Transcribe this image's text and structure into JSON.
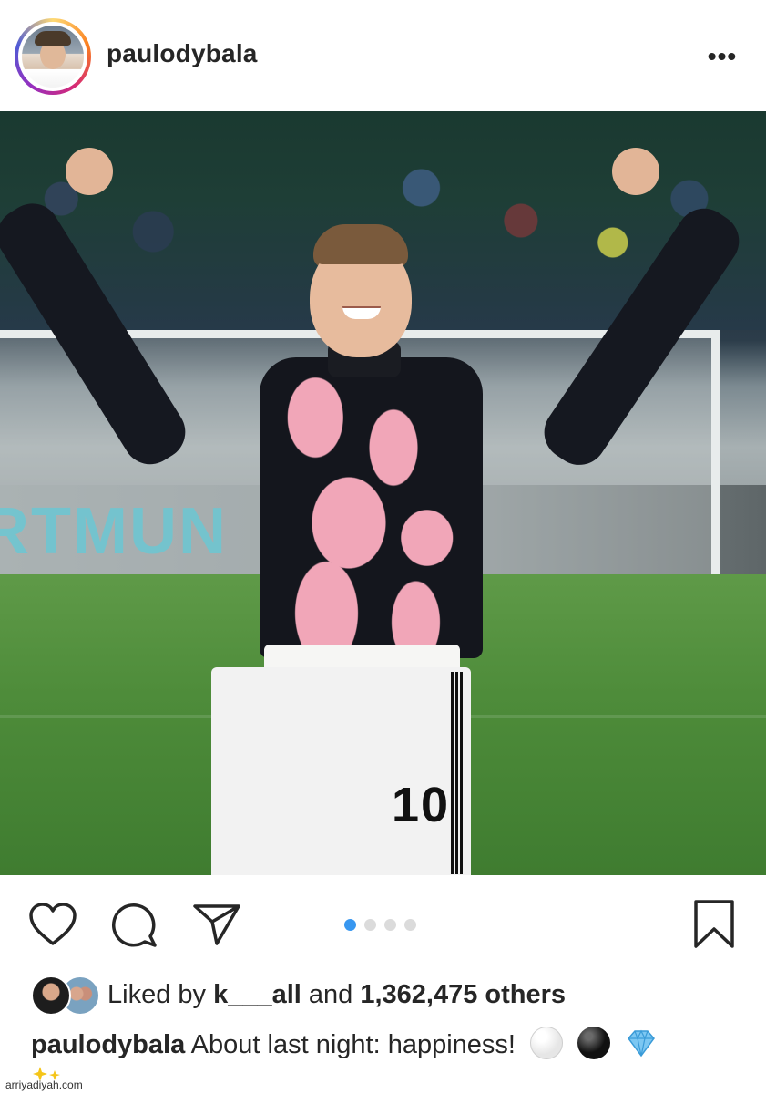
{
  "header": {
    "username": "paulodybala",
    "more_label": "•••"
  },
  "post": {
    "carousel_total": 4,
    "carousel_active_index": 0,
    "photo": {
      "ad_board_text": "RTMUN",
      "jersey_number": "10"
    }
  },
  "likes": {
    "prefix": "Liked by",
    "user": "k___all",
    "joiner": "and",
    "count": "1,362,475 others"
  },
  "caption": {
    "username": "paulodybala",
    "text": "About last night: happiness!"
  },
  "watermark": "arriyadiyah.com",
  "colors": {
    "accent": "#3897f0",
    "text": "#262626",
    "dot_inactive": "#dbdbdb"
  },
  "icons": [
    "heart-icon",
    "comment-icon",
    "share-icon",
    "bookmark-icon",
    "more-icon"
  ]
}
